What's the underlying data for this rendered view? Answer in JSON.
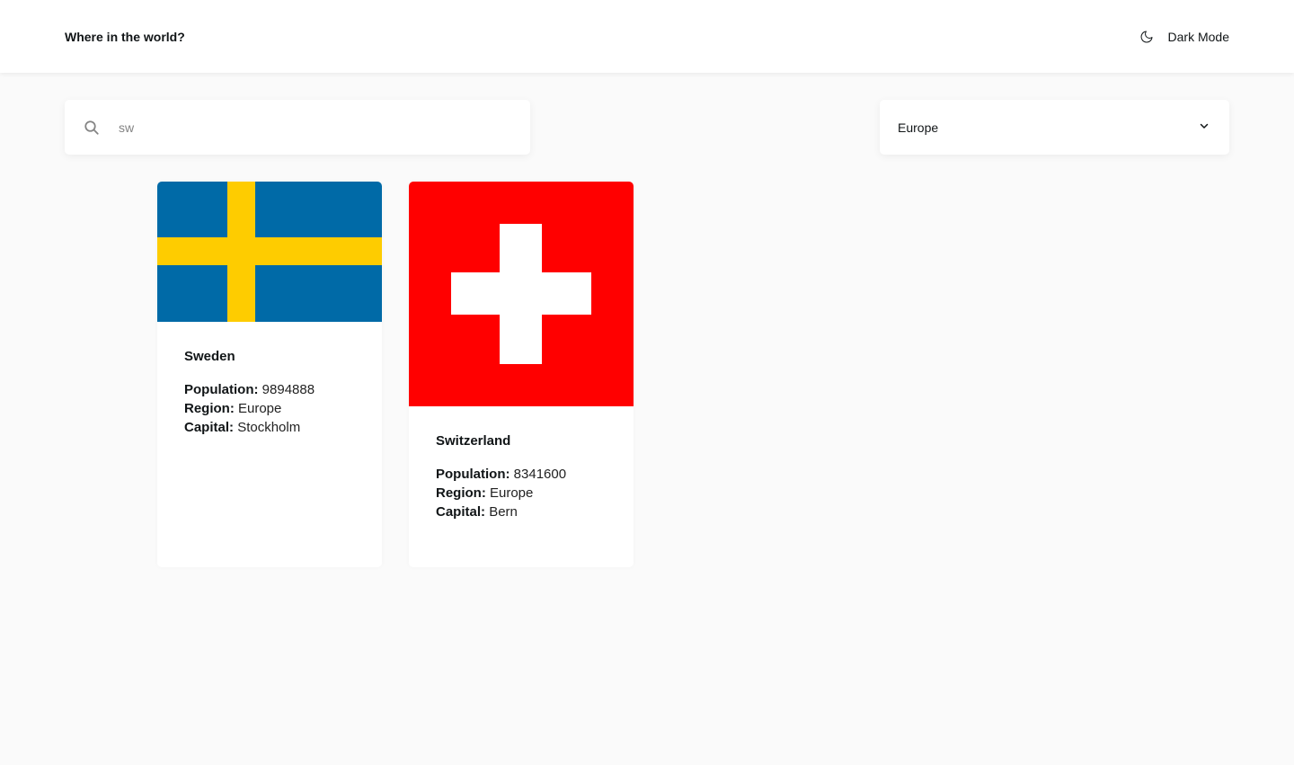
{
  "header": {
    "title": "Where in the world?",
    "dark_mode_label": "Dark Mode",
    "dark_mode_icon": "moon-icon"
  },
  "search": {
    "value": "sw",
    "icon": "search-icon"
  },
  "filter": {
    "selected": "Europe",
    "icon": "chevron-down-icon"
  },
  "countries": [
    {
      "name": "Sweden",
      "population_label": "Population:",
      "population": "9894888",
      "region_label": "Region:",
      "region": "Europe",
      "capital_label": "Capital:",
      "capital": "Stockholm",
      "flag": "sweden-flag",
      "flag_colors": {
        "blue": "#006AA7",
        "yellow": "#FECC00"
      }
    },
    {
      "name": "Switzerland",
      "population_label": "Population:",
      "population": "8341600",
      "region_label": "Region:",
      "region": "Europe",
      "capital_label": "Capital:",
      "capital": "Bern",
      "flag": "switzerland-flag",
      "flag_colors": {
        "red": "#FF0000",
        "white": "#FFFFFF"
      }
    }
  ],
  "colors": {
    "background": "#fafafa",
    "surface": "#ffffff",
    "text": "#111517",
    "input_text": "#848484"
  }
}
